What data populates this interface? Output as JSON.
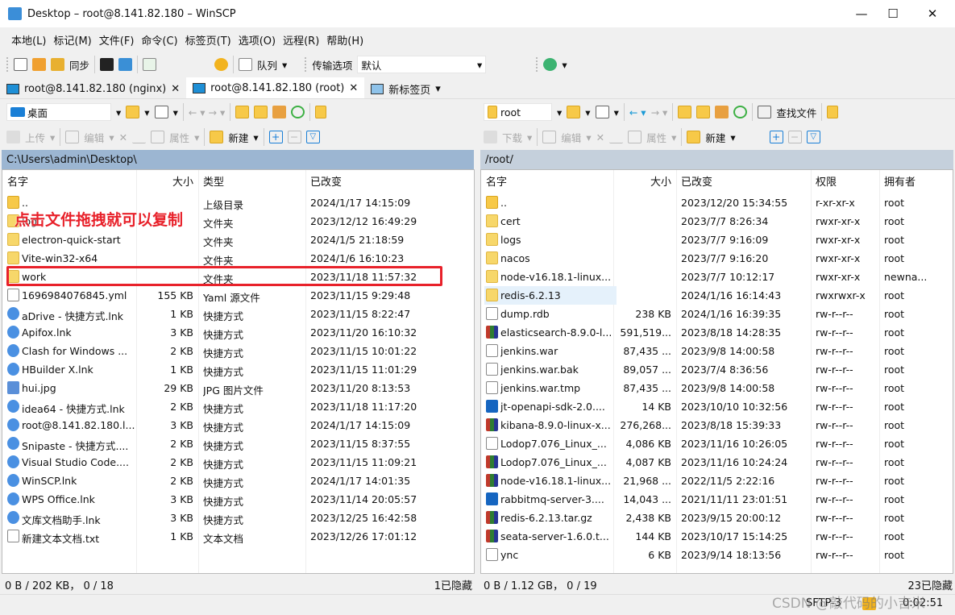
{
  "window": {
    "title": "Desktop – root@8.141.82.180 – WinSCP",
    "minimize": "—",
    "maximize": "☐",
    "close": "✕"
  },
  "menu": [
    "本地(L)",
    "标记(M)",
    "文件(F)",
    "命令(C)",
    "标签页(T)",
    "选项(O)",
    "远程(R)",
    "帮助(H)"
  ],
  "toolbar": {
    "sync": "同步",
    "queue": "队列",
    "transfer_label": "传输选项",
    "transfer_value": "默认"
  },
  "tabs": [
    {
      "label": "root@8.141.82.180 (nginx)",
      "close": "✕"
    },
    {
      "label": "root@8.141.82.180 (root)",
      "close": "✕"
    },
    {
      "label": "新标签页"
    }
  ],
  "left": {
    "location": "桌面",
    "upload": "上传",
    "edit": "编辑",
    "properties": "属性",
    "new": "新建",
    "path": "C:\\Users\\admin\\Desktop\\",
    "headers": [
      "名字",
      "大小",
      "类型",
      "已改变"
    ],
    "rows": [
      [
        "..",
        "",
        "上级目录",
        "2024/1/17 14:15:09",
        "up"
      ],
      [
        "log",
        "",
        "文件夹",
        "2023/12/12 16:49:29",
        "folder"
      ],
      [
        "electron-quick-start",
        "",
        "文件夹",
        "2024/1/5 21:18:59",
        "folder"
      ],
      [
        "Vite-win32-x64",
        "",
        "文件夹",
        "2024/1/6 16:10:23",
        "folder"
      ],
      [
        "work",
        "",
        "文件夹",
        "2023/11/18 11:57:32",
        "folder"
      ],
      [
        "1696984076845.yml",
        "155 KB",
        "Yaml 源文件",
        "2023/11/15 9:29:48",
        "file"
      ],
      [
        "aDrive - 快捷方式.lnk",
        "1 KB",
        "快捷方式",
        "2023/11/15 8:22:47",
        "link"
      ],
      [
        "Apifox.lnk",
        "3 KB",
        "快捷方式",
        "2023/11/20 16:10:32",
        "link"
      ],
      [
        "Clash for Windows ...",
        "2 KB",
        "快捷方式",
        "2023/11/15 10:01:22",
        "link"
      ],
      [
        "HBuilder X.lnk",
        "1 KB",
        "快捷方式",
        "2023/11/15 11:01:29",
        "link"
      ],
      [
        "hui.jpg",
        "29 KB",
        "JPG 图片文件",
        "2023/11/20 8:13:53",
        "image"
      ],
      [
        "idea64 - 快捷方式.lnk",
        "2 KB",
        "快捷方式",
        "2023/11/18 11:17:20",
        "link"
      ],
      [
        "root@8.141.82.180.l...",
        "3 KB",
        "快捷方式",
        "2024/1/17 14:15:09",
        "link"
      ],
      [
        "Snipaste - 快捷方式....",
        "2 KB",
        "快捷方式",
        "2023/11/15 8:37:55",
        "link"
      ],
      [
        "Visual Studio Code....",
        "2 KB",
        "快捷方式",
        "2023/11/15 11:09:21",
        "link"
      ],
      [
        "WinSCP.lnk",
        "2 KB",
        "快捷方式",
        "2024/1/17 14:01:35",
        "link"
      ],
      [
        "WPS Office.lnk",
        "3 KB",
        "快捷方式",
        "2023/11/14 20:05:57",
        "link"
      ],
      [
        "文库文档助手.lnk",
        "3 KB",
        "快捷方式",
        "2023/12/25 16:42:58",
        "link"
      ],
      [
        "新建文本文档.txt",
        "1 KB",
        "文本文档",
        "2023/12/26 17:01:12",
        "file"
      ]
    ],
    "status": "0 B / 202 KB， 0 / 18",
    "hidden": "1已隐藏"
  },
  "right": {
    "location": "root",
    "download": "下载",
    "edit": "编辑",
    "properties": "属性",
    "new": "新建",
    "find": "查找文件",
    "path": "/root/",
    "headers": [
      "名字",
      "大小",
      "已改变",
      "权限",
      "拥有者"
    ],
    "rows": [
      [
        "..",
        "",
        "2023/12/20 15:34:55",
        "r-xr-xr-x",
        "root",
        "up"
      ],
      [
        "cert",
        "",
        "2023/7/7 8:26:34",
        "rwxr-xr-x",
        "root",
        "folder"
      ],
      [
        "logs",
        "",
        "2023/7/7 9:16:09",
        "rwxr-xr-x",
        "root",
        "folder"
      ],
      [
        "nacos",
        "",
        "2023/7/7 9:16:20",
        "rwxr-xr-x",
        "root",
        "folder"
      ],
      [
        "node-v16.18.1-linux...",
        "",
        "2023/7/7 10:12:17",
        "rwxr-xr-x",
        "newna...",
        "folder"
      ],
      [
        "redis-6.2.13",
        "",
        "2024/1/16 16:14:43",
        "rwxrwxr-x",
        "root",
        "folder"
      ],
      [
        "dump.rdb",
        "238 KB",
        "2024/1/16 16:39:35",
        "rw-r--r--",
        "root",
        "file"
      ],
      [
        "elasticsearch-8.9.0-l...",
        "591,519...",
        "2023/8/18 14:28:35",
        "rw-r--r--",
        "root",
        "archive"
      ],
      [
        "jenkins.war",
        "87,435 ...",
        "2023/9/8 14:00:58",
        "rw-r--r--",
        "root",
        "file"
      ],
      [
        "jenkins.war.bak",
        "89,057 ...",
        "2023/7/4 8:36:56",
        "rw-r--r--",
        "root",
        "file"
      ],
      [
        "jenkins.war.tmp",
        "87,435 ...",
        "2023/9/8 14:00:58",
        "rw-r--r--",
        "root",
        "file"
      ],
      [
        "jt-openapi-sdk-2.0....",
        "14 KB",
        "2023/10/10 10:32:56",
        "rw-r--r--",
        "root",
        "jar"
      ],
      [
        "kibana-8.9.0-linux-x...",
        "276,268...",
        "2023/8/18 15:39:33",
        "rw-r--r--",
        "root",
        "archive"
      ],
      [
        "Lodop7.076_Linux_...",
        "4,086 KB",
        "2023/11/16 10:26:05",
        "rw-r--r--",
        "root",
        "file"
      ],
      [
        "Lodop7.076_Linux_...",
        "4,087 KB",
        "2023/11/16 10:24:24",
        "rw-r--r--",
        "root",
        "archive"
      ],
      [
        "node-v16.18.1-linux...",
        "21,968 ...",
        "2022/11/5 2:22:16",
        "rw-r--r--",
        "root",
        "archive"
      ],
      [
        "rabbitmq-server-3....",
        "14,043 ...",
        "2021/11/11 23:01:51",
        "rw-r--r--",
        "root",
        "jar"
      ],
      [
        "redis-6.2.13.tar.gz",
        "2,438 KB",
        "2023/9/15 20:00:12",
        "rw-r--r--",
        "root",
        "archive"
      ],
      [
        "seata-server-1.6.0.t...",
        "144 KB",
        "2023/10/17 15:14:25",
        "rw-r--r--",
        "root",
        "archive"
      ],
      [
        "ync",
        "6 KB",
        "2023/9/14 18:13:56",
        "rw-r--r--",
        "root",
        "file"
      ]
    ],
    "status": "0 B / 1.12 GB， 0 / 19",
    "hidden": "23已隐藏"
  },
  "bottom": {
    "protocol": "SFTP-3",
    "time": "0:02:51"
  },
  "annotation": {
    "text": "点击文件拖拽就可以复制",
    "color": "#e8212a"
  },
  "watermark": "CSDN @敲代码的小吉米",
  "colors": {
    "path_bar_left": "#9cb6d2",
    "path_bar_right": "#c5d0dc",
    "selection": "#e5f1fb",
    "highlight_box": "#e8212a"
  }
}
